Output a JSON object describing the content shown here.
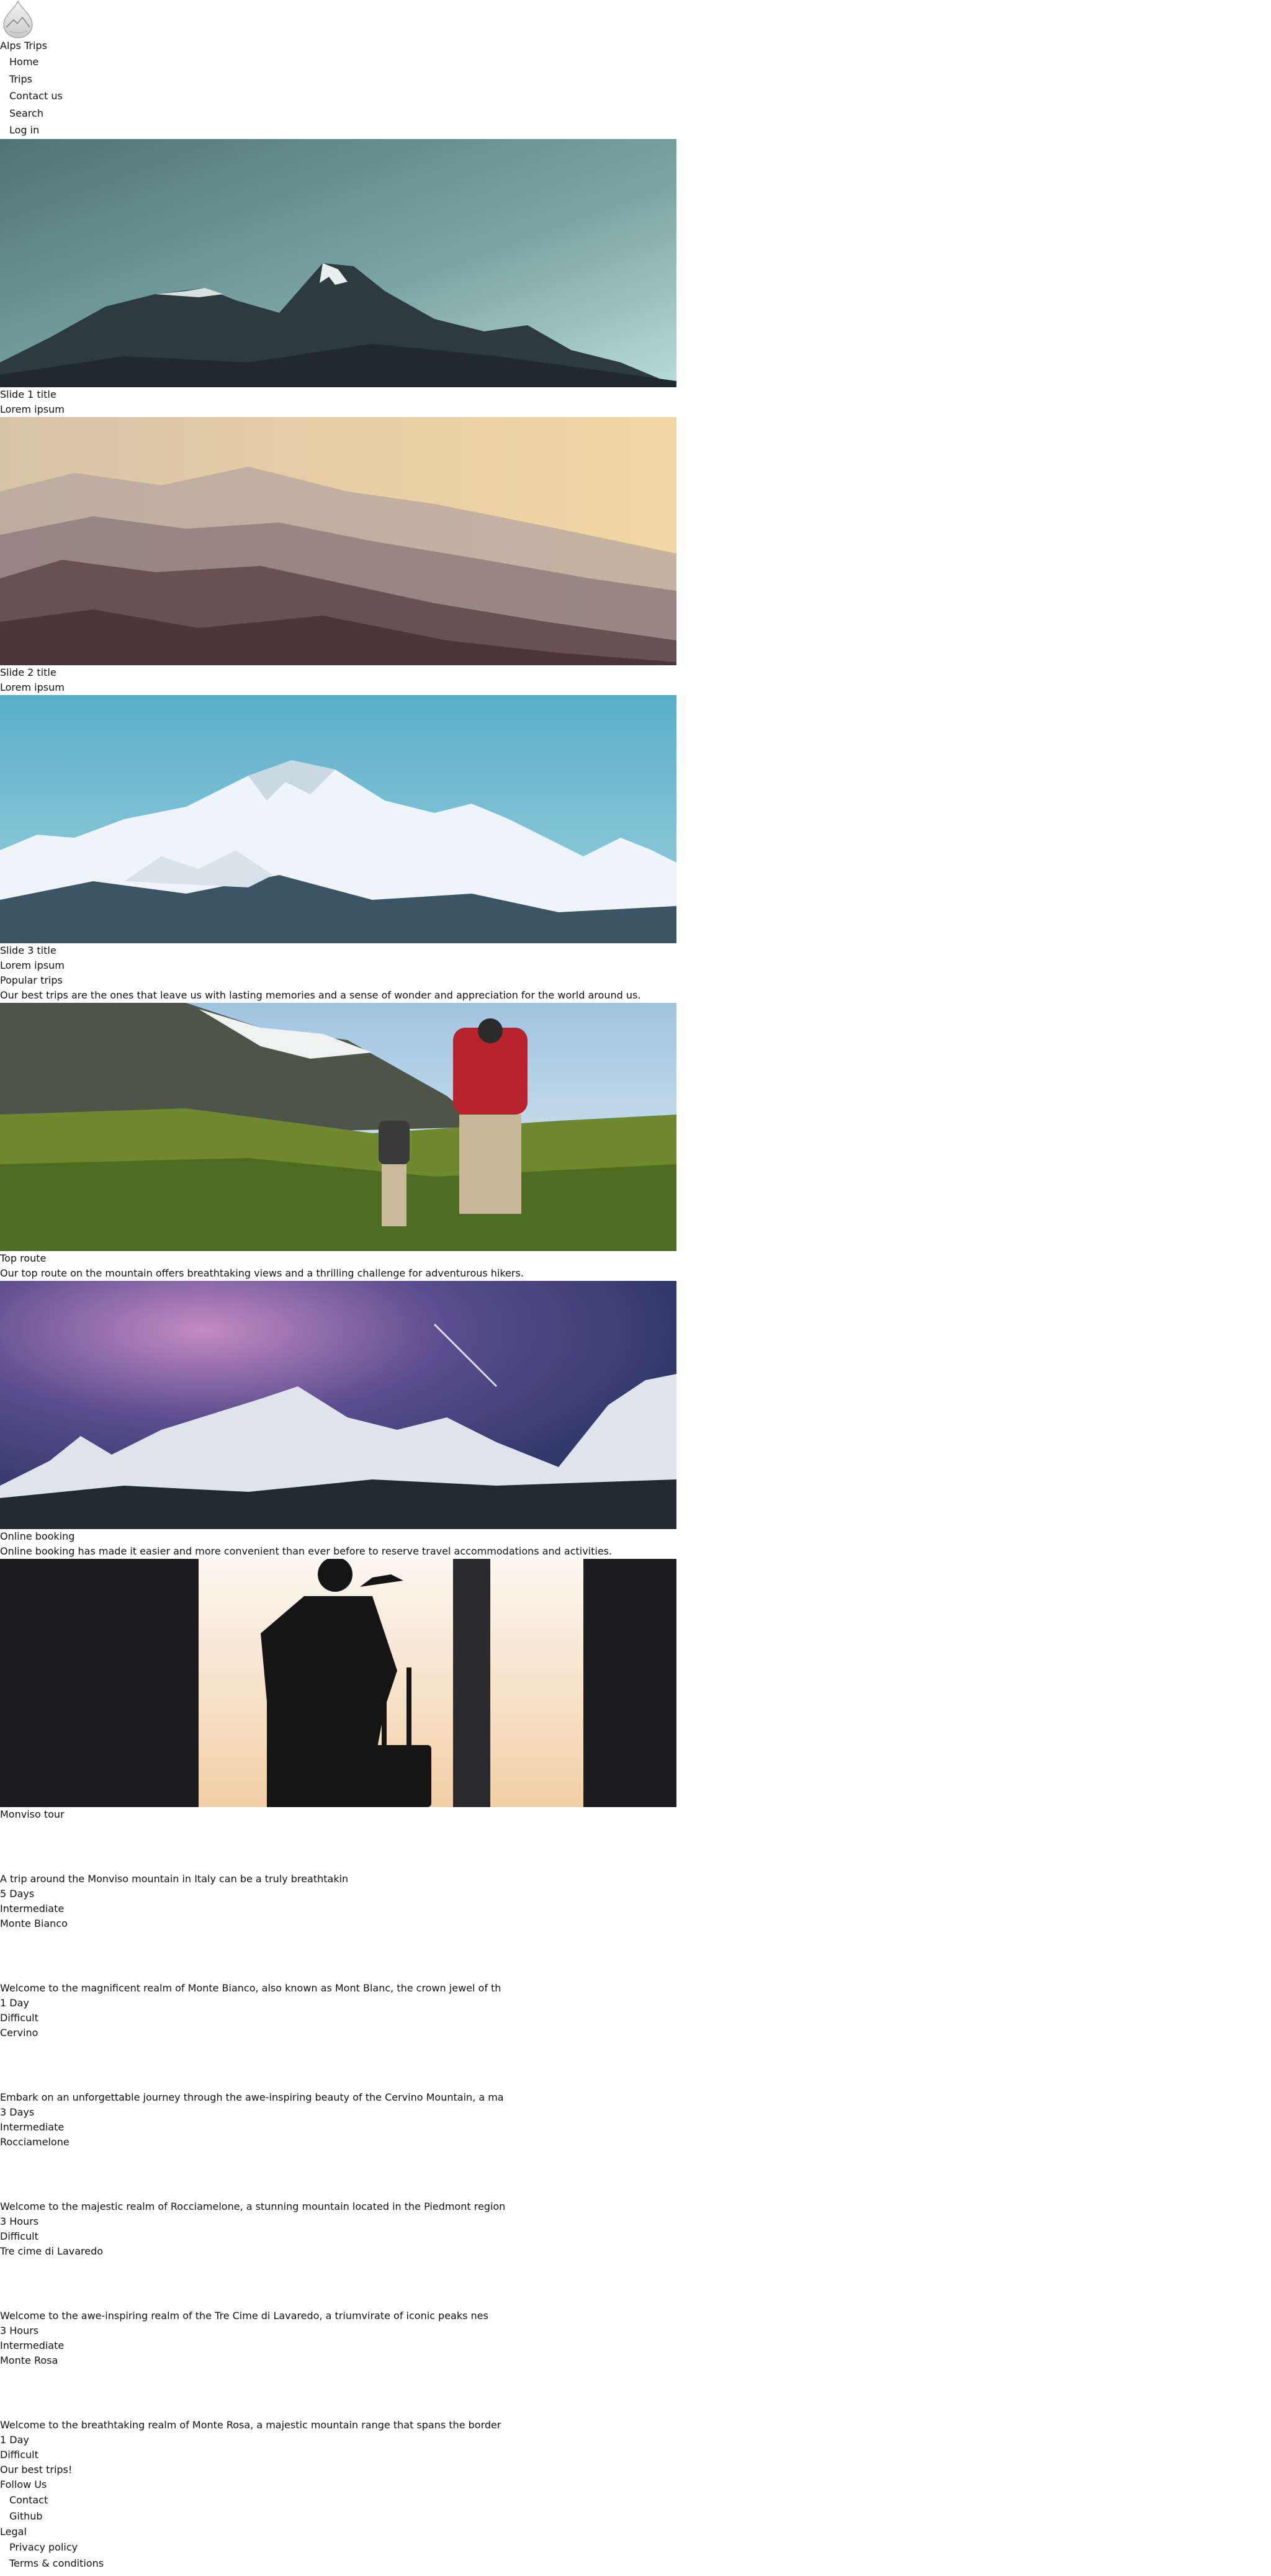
{
  "brand": {
    "name": "Alps Trips",
    "logo_icon": "mountain-drop-logo"
  },
  "nav": {
    "items": [
      {
        "label": "Home"
      },
      {
        "label": "Trips"
      },
      {
        "label": "Contact us"
      },
      {
        "label": "Search"
      },
      {
        "label": "Log in"
      }
    ]
  },
  "slides": [
    {
      "title": "Slide 1 title",
      "subtitle": "Lorem ipsum"
    },
    {
      "title": "Slide 2 title",
      "subtitle": "Lorem ipsum"
    },
    {
      "title": "Slide 3 title",
      "subtitle": "Lorem ipsum"
    }
  ],
  "popular": {
    "heading": "Popular trips",
    "intro": "Our best trips are the ones that leave us with lasting memories and a sense of wonder and appreciation for the world around us."
  },
  "features": [
    {
      "title": "Top route",
      "text": "Our top route on the mountain offers breathtaking views and a thrilling challenge for adventurous hikers."
    },
    {
      "title": "Online booking",
      "text": "Online booking has made it easier and more convenient than ever before to reserve travel accommodations and activities."
    }
  ],
  "trips": [
    {
      "name": "Monviso tour",
      "desc": "A trip around the Monviso mountain in Italy can be a truly breathtakin",
      "duration": "5 Days",
      "level": "Intermediate"
    },
    {
      "name": "Monte Bianco",
      "desc": "Welcome to the magnificent realm of Monte Bianco, also known as Mont Blanc, the crown jewel of th",
      "duration": "1 Day",
      "level": "Difficult"
    },
    {
      "name": "Cervino",
      "desc": "Embark on an unforgettable journey through the awe-inspiring beauty of the Cervino Mountain, a ma",
      "duration": "3 Days",
      "level": "Intermediate"
    },
    {
      "name": "Rocciamelone",
      "desc": "Welcome to the majestic realm of Rocciamelone, a stunning mountain located in the Piedmont region",
      "duration": "3 Hours",
      "level": "Difficult"
    },
    {
      "name": "Tre cime di Lavaredo",
      "desc": "Welcome to the awe-inspiring realm of the Tre Cime di Lavaredo, a triumvirate of iconic peaks nes",
      "duration": "3 Hours",
      "level": "Intermediate"
    },
    {
      "name": "Monte Rosa",
      "desc": "Welcome to the breathtaking realm of Monte Rosa, a majestic mountain range that spans the border",
      "duration": "1 Day",
      "level": "Difficult"
    }
  ],
  "footer": {
    "tagline": "Our best trips!",
    "follow_heading": "Follow Us",
    "follow_links": [
      {
        "label": "Contact"
      },
      {
        "label": "Github"
      }
    ],
    "legal_heading": "Legal",
    "legal_links": [
      {
        "label": "Privacy policy"
      },
      {
        "label": "Terms & conditions"
      }
    ]
  }
}
